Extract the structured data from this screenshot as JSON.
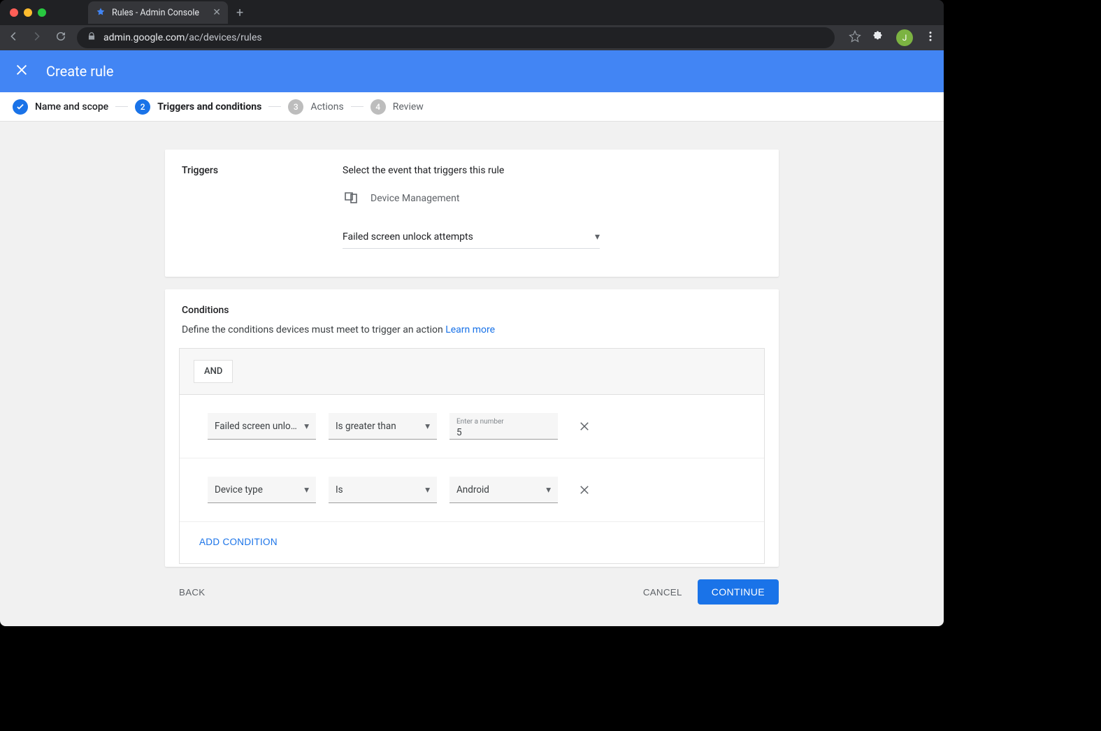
{
  "browser": {
    "tab_title": "Rules - Admin Console",
    "url_domain": "admin.google.com",
    "url_path": "/ac/devices/rules",
    "avatar_initial": "J"
  },
  "header": {
    "title": "Create rule"
  },
  "steps": [
    {
      "label": "Name and scope",
      "state": "done"
    },
    {
      "label": "Triggers and conditions",
      "state": "active",
      "num": "2"
    },
    {
      "label": "Actions",
      "state": "upcoming",
      "num": "3"
    },
    {
      "label": "Review",
      "state": "upcoming",
      "num": "4"
    }
  ],
  "triggers": {
    "section_title": "Triggers",
    "description": "Select the event that triggers this rule",
    "category_label": "Device Management",
    "selected_trigger": "Failed screen unlock attempts"
  },
  "conditions": {
    "section_title": "Conditions",
    "description": "Define the conditions devices must meet to trigger an action ",
    "learn_more": "Learn more",
    "logic_chip": "AND",
    "rows": [
      {
        "field": "Failed screen unlock …",
        "op": "Is greater than",
        "value_label": "Enter a number",
        "value": "5",
        "value_type": "number"
      },
      {
        "field": "Device type",
        "op": "Is",
        "value": "Android",
        "value_type": "select"
      }
    ],
    "add_label": "ADD CONDITION"
  },
  "footer": {
    "back": "BACK",
    "cancel": "CANCEL",
    "continue": "CONTINUE"
  }
}
